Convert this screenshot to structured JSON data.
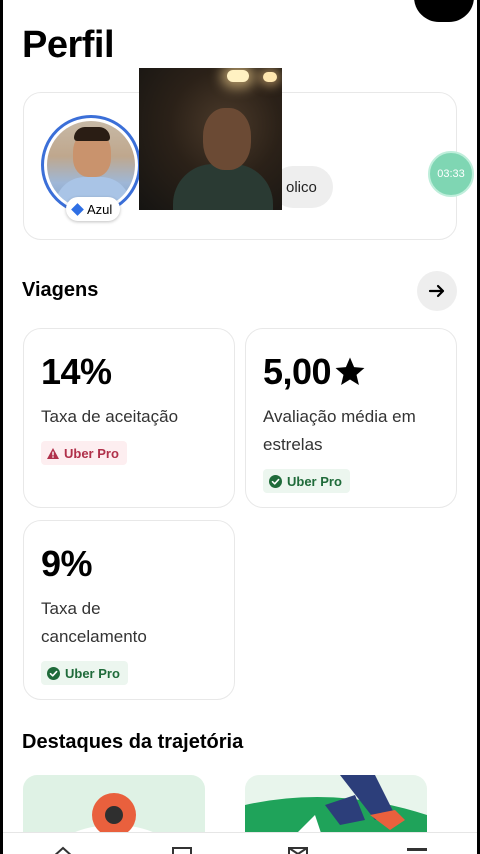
{
  "page": {
    "title": "Perfil"
  },
  "profile": {
    "tier_label": "Azul",
    "public_label": "olico",
    "tier_color": "#2f6fe4",
    "ring_color": "#3b6fd8"
  },
  "recording": {
    "timer": "03:33"
  },
  "trips": {
    "title": "Viagens",
    "stats": [
      {
        "value": "14%",
        "label": "Taxa de aceitação",
        "tag": "Uber Pro",
        "tag_status": "warning",
        "tag_color": "#b0304a"
      },
      {
        "value": "5,00",
        "label": "Avaliação média em estrelas",
        "tag": "Uber Pro",
        "tag_status": "ok",
        "tag_color": "#1f6b3a",
        "icon": "star-icon"
      },
      {
        "value": "9%",
        "label": "Taxa de cancelamento",
        "tag": "Uber Pro",
        "tag_status": "ok",
        "tag_color": "#1f6b3a"
      }
    ]
  },
  "highlights": {
    "title": "Destaques da trajetória"
  },
  "nav": {
    "items": [
      "home-icon",
      "earnings-icon",
      "inbox-icon",
      "menu-icon"
    ]
  }
}
